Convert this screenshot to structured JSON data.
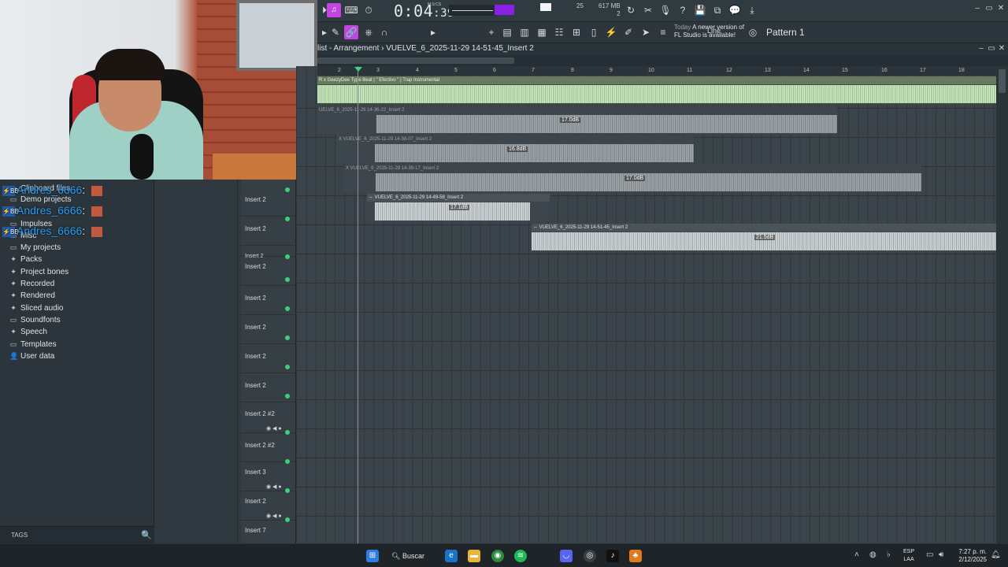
{
  "webcam": {
    "chat": [
      {
        "badge": "⚡BB",
        "name": "Andres_6666",
        "colon": ":"
      },
      {
        "badge": "⚡BB",
        "name": "Andres_6666",
        "colon": ":"
      },
      {
        "badge": "⚡BB",
        "name": "Andres_6666",
        "colon": ":"
      }
    ]
  },
  "toolbar": {
    "time": "0:04",
    "time_small": ":39",
    "time_unit": "M:S:CS",
    "cpu": "25",
    "memory": "617 MB",
    "memory_sub": "2",
    "pattern": "Pattern 1",
    "snap": "Line",
    "news_today": "Today",
    "news_text_1": "A newer version of",
    "news_text_2": "FL Studio is available!",
    "win_minimize": "–",
    "win_maximize": "▭",
    "win_close": "✕"
  },
  "breadcrumb": {
    "text": "list - Arrangement  ›  VUELVE_6_2025-11-29 14-51-45_Insert 2"
  },
  "browser": {
    "items": [
      {
        "icon": "▭",
        "label": "Clipboard files"
      },
      {
        "icon": "▭",
        "label": "Demo projects"
      },
      {
        "icon": "▭",
        "label": "Impulses"
      },
      {
        "icon": "▭",
        "label": "Misc"
      },
      {
        "icon": "▭",
        "label": "My projects"
      },
      {
        "icon": "✦",
        "label": "Packs"
      },
      {
        "icon": "✦",
        "label": "Project bones"
      },
      {
        "icon": "✦",
        "label": "Recorded"
      },
      {
        "icon": "✦",
        "label": "Rendered"
      },
      {
        "icon": "✦",
        "label": "Sliced audio"
      },
      {
        "icon": "▭",
        "label": "Soundfonts"
      },
      {
        "icon": "✦",
        "label": "Speech"
      },
      {
        "icon": "▭",
        "label": "Templates"
      },
      {
        "icon": "👤",
        "label": "User data"
      }
    ],
    "tags_label": "TAGS"
  },
  "tracks": [
    {
      "name": "Insert 2"
    },
    {
      "name": "Insert 2"
    },
    {
      "name": "Insert 2"
    },
    {
      "name": "Insert 2"
    },
    {
      "name": "Insert 2"
    },
    {
      "name": "Insert 2"
    },
    {
      "name": "Insert 2"
    },
    {
      "name": "Insert 2"
    },
    {
      "name": "Insert 2 #2"
    },
    {
      "name": "Insert 2 #2"
    },
    {
      "name": "Insert 3"
    },
    {
      "name": "Insert 2"
    },
    {
      "name": "Insert 7"
    }
  ],
  "ruler": [
    "2",
    "3",
    "4",
    "5",
    "6",
    "7",
    "8",
    "9",
    "10",
    "11",
    "12",
    "13",
    "14",
    "15",
    "16",
    "17",
    "18"
  ],
  "clips": [
    {
      "title": "R x GeezyDee Type Beat  |  \" Efectivo \"  |  Trap Instrumental",
      "db": ""
    },
    {
      "title": "UELVE_6_2025-11-29 14-36-22_Insert 2",
      "db": "17.0dB"
    },
    {
      "title": "X  VUELVE_6_2025-11-29 14-38-07_Insert 2",
      "db": "16.8dB"
    },
    {
      "title": "X  VUELVE_6_2025-11-29 14-39-17_Insert 2",
      "db": "17.0dB"
    },
    {
      "title": "⇔ VUELVE_6_2025-11-29 14-49-58_Insert 2",
      "db": "17.1dB"
    },
    {
      "title": "⇔ VUELVE_6_2025-11-29 14-51-45_Insert 2",
      "db": "21.5dB"
    }
  ],
  "taskbar": {
    "search": "Buscar",
    "lang_1": "ESP",
    "lang_2": "LAA",
    "time": "7:27 p. m.",
    "date": "2/12/2025"
  }
}
